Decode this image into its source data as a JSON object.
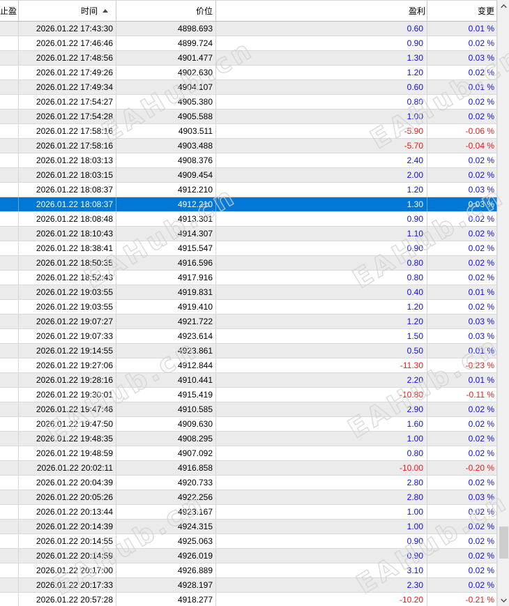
{
  "app": {
    "title": "trade history list"
  },
  "colors": {
    "selection_bg": "#0078d7",
    "selection_text": "#ffffff",
    "positive_value": "#0f0fe0",
    "negative_value": "#f21717",
    "row_stripe": "#ebebeb",
    "gridline": "#d6d6d6",
    "scrollbar_track": "#f0f0f0",
    "scrollbar_thumb": "#cdcdcd",
    "watermark_stroke": "#d2d2d2"
  },
  "watermark": {
    "text": "EAHub.cn"
  },
  "header": {
    "columns": [
      {
        "id": "tp",
        "label": "止盈"
      },
      {
        "id": "time",
        "label": "时间",
        "sort": "ascending"
      },
      {
        "id": "price",
        "label": "价位"
      },
      {
        "id": "profit",
        "label": "盈利"
      },
      {
        "id": "change",
        "label": "变更"
      }
    ]
  },
  "scrollbar": {
    "up_icon": "chevron-up",
    "down_icon": "chevron-down"
  },
  "table": {
    "selected_row_index": 12,
    "rows": [
      {
        "tp": "",
        "time": "2026.01.22 17:43:30",
        "price": "4898.693",
        "profit": "0.60",
        "change": "0.01 %"
      },
      {
        "tp": "",
        "time": "2026.01.22 17:46:46",
        "price": "4899.724",
        "profit": "0.90",
        "change": "0.02 %"
      },
      {
        "tp": "",
        "time": "2026.01.22 17:48:56",
        "price": "4901.477",
        "profit": "1.30",
        "change": "0.03 %"
      },
      {
        "tp": "",
        "time": "2026.01.22 17:49:26",
        "price": "4902.630",
        "profit": "1.20",
        "change": "0.02 %"
      },
      {
        "tp": "",
        "time": "2026.01.22 17:49:34",
        "price": "4904.107",
        "profit": "0.60",
        "change": "0.01 %"
      },
      {
        "tp": "",
        "time": "2026.01.22 17:54:27",
        "price": "4905.380",
        "profit": "0.80",
        "change": "0.02 %"
      },
      {
        "tp": "",
        "time": "2026.01.22 17:54:28",
        "price": "4905.588",
        "profit": "1.00",
        "change": "0.02 %"
      },
      {
        "tp": "",
        "time": "2026.01.22 17:58:16",
        "price": "4903.511",
        "profit": "-5.90",
        "change": "-0.06 %"
      },
      {
        "tp": "",
        "time": "2026.01.22 17:58:16",
        "price": "4903.488",
        "profit": "-5.70",
        "change": "-0.04 %"
      },
      {
        "tp": "",
        "time": "2026.01.22 18:03:13",
        "price": "4908.376",
        "profit": "2.40",
        "change": "0.02 %"
      },
      {
        "tp": "",
        "time": "2026.01.22 18:03:15",
        "price": "4909.454",
        "profit": "2.00",
        "change": "0.02 %"
      },
      {
        "tp": "",
        "time": "2026.01.22 18:08:37",
        "price": "4912.210",
        "profit": "1.20",
        "change": "0.03 %"
      },
      {
        "tp": "",
        "time": "2026.01.22 18:08:37",
        "price": "4912.210",
        "profit": "1.30",
        "change": "0.03 %"
      },
      {
        "tp": "",
        "time": "2026.01.22 18:08:48",
        "price": "4913.301",
        "profit": "0.90",
        "change": "0.02 %"
      },
      {
        "tp": "",
        "time": "2026.01.22 18:10:43",
        "price": "4914.307",
        "profit": "1.10",
        "change": "0.02 %"
      },
      {
        "tp": "",
        "time": "2026.01.22 18:38:41",
        "price": "4915.547",
        "profit": "0.90",
        "change": "0.02 %"
      },
      {
        "tp": "",
        "time": "2026.01.22 18:50:35",
        "price": "4916.596",
        "profit": "0.80",
        "change": "0.02 %"
      },
      {
        "tp": "",
        "time": "2026.01.22 18:52:43",
        "price": "4917.916",
        "profit": "0.80",
        "change": "0.02 %"
      },
      {
        "tp": "",
        "time": "2026.01.22 19:03:55",
        "price": "4919.831",
        "profit": "0.40",
        "change": "0.01 %"
      },
      {
        "tp": "",
        "time": "2026.01.22 19:03:55",
        "price": "4919.410",
        "profit": "1.20",
        "change": "0.02 %"
      },
      {
        "tp": "",
        "time": "2026.01.22 19:07:27",
        "price": "4921.722",
        "profit": "1.20",
        "change": "0.03 %"
      },
      {
        "tp": "",
        "time": "2026.01.22 19:07:33",
        "price": "4923.614",
        "profit": "1.50",
        "change": "0.03 %"
      },
      {
        "tp": "",
        "time": "2026.01.22 19:14:55",
        "price": "4923.861",
        "profit": "0.50",
        "change": "0.01 %"
      },
      {
        "tp": "",
        "time": "2026.01.22 19:27:06",
        "price": "4912.844",
        "profit": "-11.30",
        "change": "-0.23 %"
      },
      {
        "tp": "",
        "time": "2026.01.22 19:28:16",
        "price": "4910.441",
        "profit": "2.20",
        "change": "0.01 %"
      },
      {
        "tp": "",
        "time": "2026.01.22 19:30:01",
        "price": "4915.419",
        "profit": "-10.80",
        "change": "-0.11 %"
      },
      {
        "tp": "",
        "time": "2026.01.22 19:47:46",
        "price": "4910.585",
        "profit": "2.90",
        "change": "0.02 %"
      },
      {
        "tp": "",
        "time": "2026.01.22 19:47:50",
        "price": "4909.630",
        "profit": "1.60",
        "change": "0.02 %"
      },
      {
        "tp": "",
        "time": "2026.01.22 19:48:35",
        "price": "4908.295",
        "profit": "1.00",
        "change": "0.02 %"
      },
      {
        "tp": "",
        "time": "2026.01.22 19:48:59",
        "price": "4907.092",
        "profit": "0.80",
        "change": "0.02 %"
      },
      {
        "tp": "",
        "time": "2026.01.22 20:02:11",
        "price": "4916.858",
        "profit": "-10.00",
        "change": "-0.20 %"
      },
      {
        "tp": "",
        "time": "2026.01.22 20:04:39",
        "price": "4920.733",
        "profit": "2.80",
        "change": "0.02 %"
      },
      {
        "tp": "",
        "time": "2026.01.22 20:05:26",
        "price": "4922.256",
        "profit": "2.80",
        "change": "0.03 %"
      },
      {
        "tp": "",
        "time": "2026.01.22 20:13:44",
        "price": "4923.167",
        "profit": "1.00",
        "change": "0.02 %"
      },
      {
        "tp": "",
        "time": "2026.01.22 20:14:39",
        "price": "4924.315",
        "profit": "1.00",
        "change": "0.02 %"
      },
      {
        "tp": "",
        "time": "2026.01.22 20:14:55",
        "price": "4925.063",
        "profit": "0.90",
        "change": "0.02 %"
      },
      {
        "tp": "",
        "time": "2026.01.22 20:14:59",
        "price": "4926.019",
        "profit": "0.90",
        "change": "0.02 %"
      },
      {
        "tp": "",
        "time": "2026.01.22 20:17:00",
        "price": "4926.889",
        "profit": "3.10",
        "change": "0.02 %"
      },
      {
        "tp": "",
        "time": "2026.01.22 20:17:33",
        "price": "4928.197",
        "profit": "2.30",
        "change": "0.02 %"
      },
      {
        "tp": "",
        "time": "2026.01.22 20:57:28",
        "price": "4918.277",
        "profit": "-10.20",
        "change": "-0.21 %"
      }
    ]
  }
}
